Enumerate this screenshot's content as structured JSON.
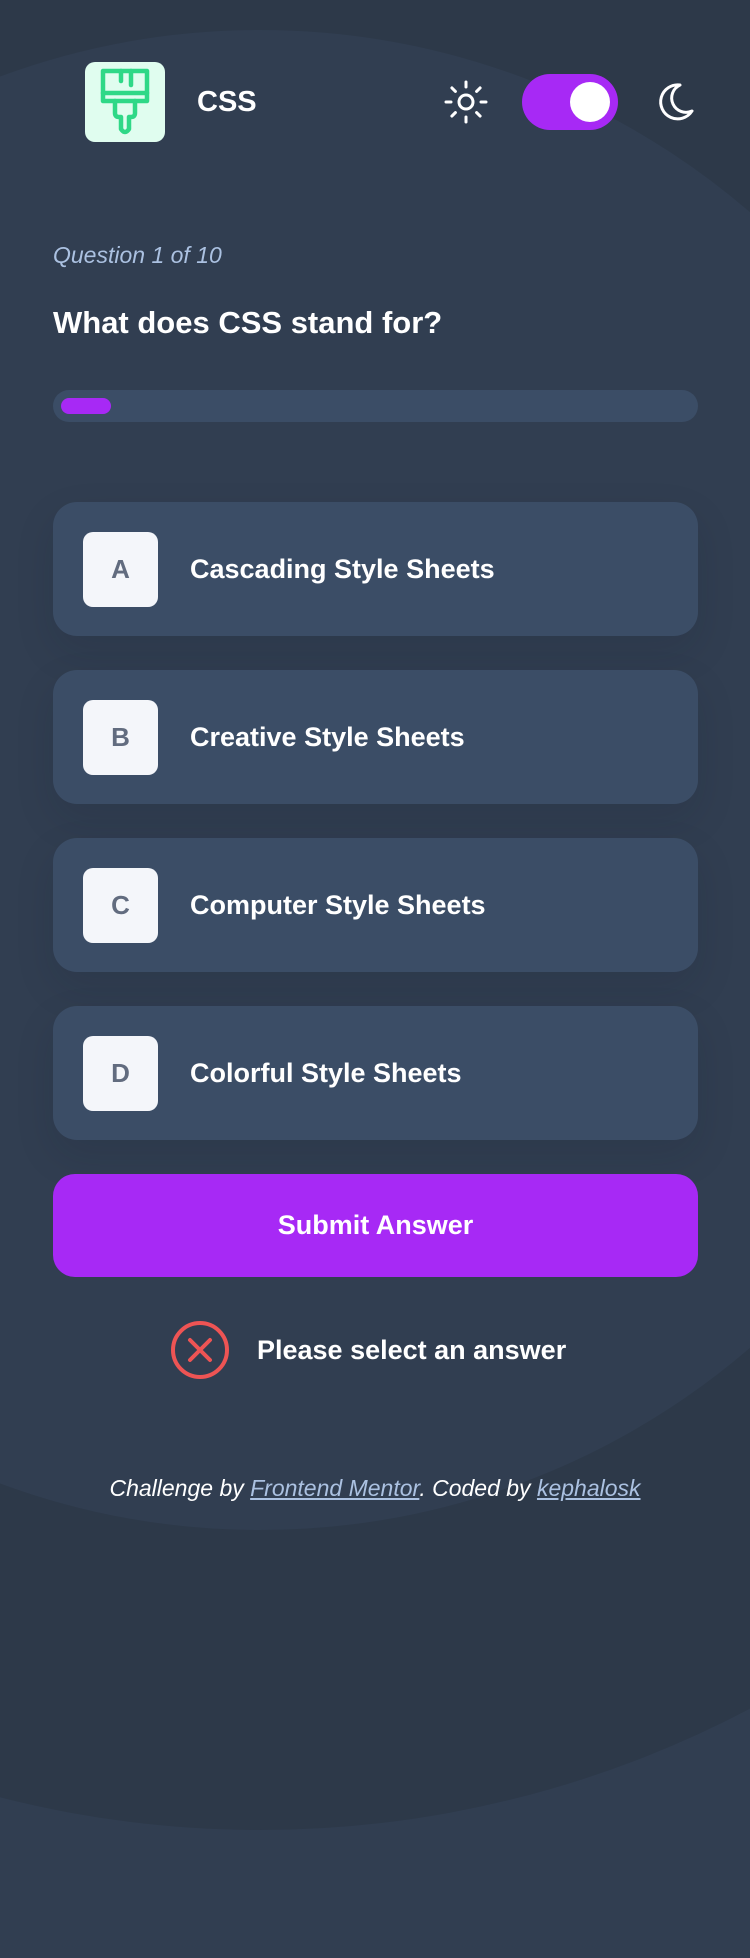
{
  "header": {
    "subject_title": "CSS",
    "subject_icon": "paintbrush-icon",
    "subject_icon_color": "#2fd887",
    "subject_icon_bg": "#e0fdef",
    "light_icon": "sun-icon",
    "dark_icon": "moon-icon",
    "dark_mode_enabled": true
  },
  "quiz": {
    "question_count": "Question 1 of 10",
    "question_text": "What does CSS stand for?",
    "progress_fraction": 0.1,
    "options": [
      {
        "letter": "A",
        "text": "Cascading Style Sheets"
      },
      {
        "letter": "B",
        "text": "Creative Style Sheets"
      },
      {
        "letter": "C",
        "text": "Computer Style Sheets"
      },
      {
        "letter": "D",
        "text": "Colorful Style Sheets"
      }
    ],
    "submit_label": "Submit Answer",
    "error_icon": "close-circle-icon",
    "error_message": "Please select an answer"
  },
  "footer": {
    "prefix": "Challenge by ",
    "link1": "Frontend Mentor",
    "middle": ". Coded by ",
    "link2": "kephalosk"
  },
  "colors": {
    "background": "#313e51",
    "card": "#3b4d66",
    "accent": "#a729f5",
    "error": "#ee5454",
    "muted_text": "#abc1e1"
  }
}
